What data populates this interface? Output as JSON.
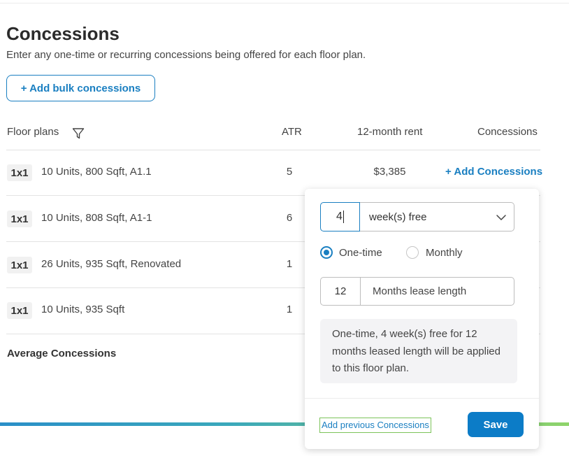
{
  "header": {
    "title": "Concessions",
    "subtitle": "Enter any one-time or recurring concessions being offered for each floor plan.",
    "bulk_button": "+ Add bulk concessions"
  },
  "table": {
    "columns": {
      "floor_plans": "Floor plans",
      "atr": "ATR",
      "rent": "12-month rent",
      "concessions": "Concessions"
    },
    "rows": [
      {
        "badge": "1x1",
        "desc": "10 Units, 800 Sqft, A1.1",
        "atr": "5",
        "rent": "$3,385",
        "action": "+ Add Concessions"
      },
      {
        "badge": "1x1",
        "desc": "10 Units, 808 Sqft, A1-1",
        "atr": "6"
      },
      {
        "badge": "1x1",
        "desc": "26 Units, 935 Sqft, Renovated",
        "atr": "1"
      },
      {
        "badge": "1x1",
        "desc": "10 Units, 935 Sqft",
        "atr": "1"
      }
    ],
    "average_label": "Average Concessions"
  },
  "popup": {
    "quantity_value": "4",
    "type_value": "week(s) free",
    "frequency": {
      "one_time": "One-time",
      "monthly": "Monthly",
      "selected": "One-time"
    },
    "lease_value": "12",
    "lease_label": "Months lease length",
    "summary": "One-time, 4 week(s) free for 12 months leased length will be applied to this floor plan.",
    "previous_link": "Add previous Concessions",
    "save_label": "Save"
  },
  "colors": {
    "accent": "#1a7fc1",
    "save_button": "#0c7cc7",
    "focus_outline": "#7cc35a",
    "summary_bg": "#f3f3f5"
  },
  "icons": [
    "filter-icon",
    "chevron-down-icon"
  ]
}
